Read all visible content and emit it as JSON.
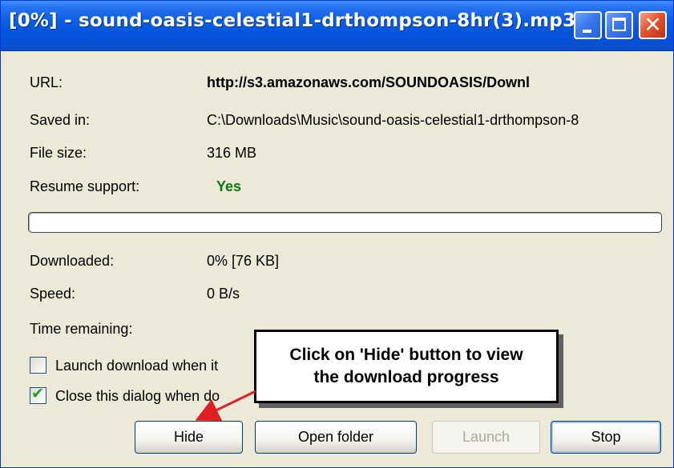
{
  "window": {
    "title": "[0%] - sound-oasis-celestial1-drthompson-8hr(3).mp3",
    "controls": {
      "minimize": "minimize",
      "maximize": "maximize",
      "close": "✕"
    }
  },
  "details": {
    "url_label": "URL:",
    "url_value": "http://s3.amazonaws.com/SOUNDOASIS/Downl",
    "saved_label": "Saved in:",
    "saved_value": "C:\\Downloads\\Music\\sound-oasis-celestial1-drthompson-8",
    "size_label": "File size:",
    "size_value": "316 MB",
    "resume_label": "Resume support:",
    "resume_value": "Yes"
  },
  "progress": {
    "percent": 0
  },
  "stats": {
    "downloaded_label": "Downloaded:",
    "downloaded_value": "0% [76 KB]",
    "speed_label": "Speed:",
    "speed_value": "0 B/s",
    "time_label": "Time remaining:"
  },
  "options": {
    "launch_label": "Launch download when it",
    "launch_checked": false,
    "close_label": "Close this dialog when do",
    "close_checked": true
  },
  "buttons": {
    "hide": "Hide",
    "open_folder": "Open folder",
    "launch": "Launch",
    "stop": "Stop"
  },
  "callout": {
    "line1": "Click on 'Hide' button to view",
    "line2": "the download progress"
  },
  "colors": {
    "title_bar": "#0553db",
    "resume_yes": "#0b7a0b",
    "arrow": "#e02020"
  }
}
